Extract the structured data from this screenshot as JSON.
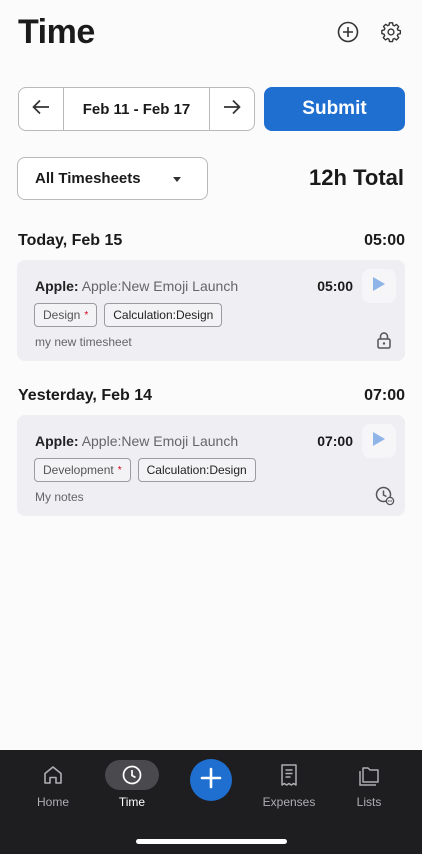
{
  "header": {
    "title": "Time"
  },
  "date_nav": {
    "range": "Feb 11 - Feb 17"
  },
  "submit_label": "Submit",
  "filter": {
    "selected": "All Timesheets"
  },
  "total": "12h Total",
  "days": [
    {
      "label": "Today, Feb 15",
      "total": "05:00",
      "entry": {
        "client": "Apple:",
        "project": "Apple:New Emoji Launch",
        "duration": "05:00",
        "tag1": "Design",
        "tag1_required": "*",
        "tag2": "Calculation:Design",
        "notes": "my new timesheet",
        "status_icon": "lock-icon"
      }
    },
    {
      "label": "Yesterday, Feb 14",
      "total": "07:00",
      "entry": {
        "client": "Apple:",
        "project": "Apple:New Emoji Launch",
        "duration": "07:00",
        "tag1": "Development",
        "tag1_required": "*",
        "tag2": "Calculation:Design",
        "notes": "My notes",
        "status_icon": "pending-approval-icon"
      }
    }
  ],
  "tabbar": {
    "home": "Home",
    "time": "Time",
    "expenses": "Expenses",
    "lists": "Lists"
  },
  "colors": {
    "accent": "#1f6fd1",
    "tabbar_bg": "#1e1e20",
    "card_bg": "#eeeef3",
    "required": "#d0021b"
  }
}
